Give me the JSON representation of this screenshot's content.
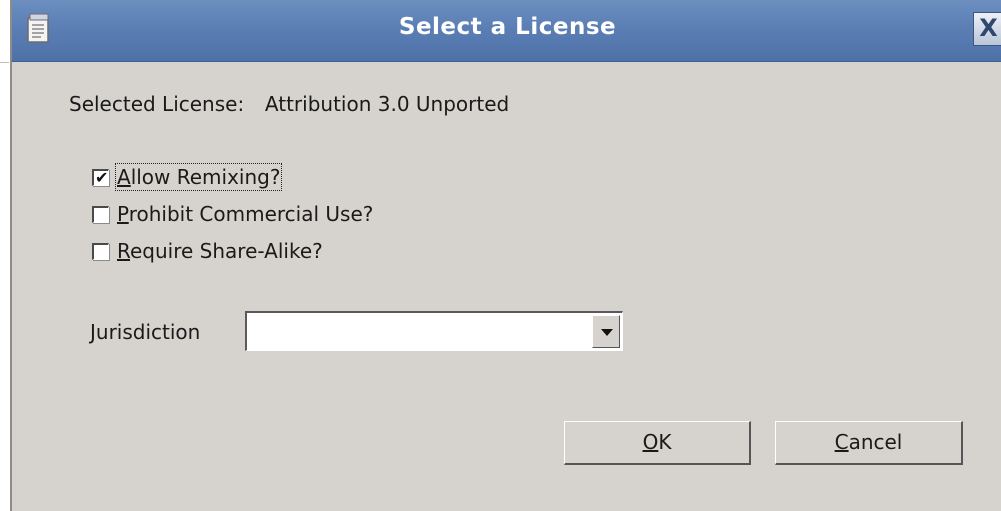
{
  "window": {
    "title": "Select a License",
    "close_glyph": "X",
    "app_icon": "document-icon"
  },
  "selected": {
    "label": "Selected License:",
    "value": "Attribution 3.0 Unported"
  },
  "options": [
    {
      "mnemonic": "A",
      "rest": "llow Remixing?",
      "checked": true
    },
    {
      "mnemonic": "P",
      "rest": "rohibit Commercial Use?",
      "checked": false
    },
    {
      "mnemonic": "R",
      "rest": "equire Share-Alike?",
      "checked": false
    }
  ],
  "jurisdiction": {
    "mnemonic": "J",
    "rest": "urisdiction",
    "value": ""
  },
  "buttons": {
    "ok": {
      "mnemonic": "O",
      "rest": "K"
    },
    "cancel": {
      "mnemonic": "C",
      "rest": "ancel"
    }
  },
  "colors": {
    "titlebar": "#5b7fb5",
    "dialog_bg": "#d6d3ce"
  }
}
